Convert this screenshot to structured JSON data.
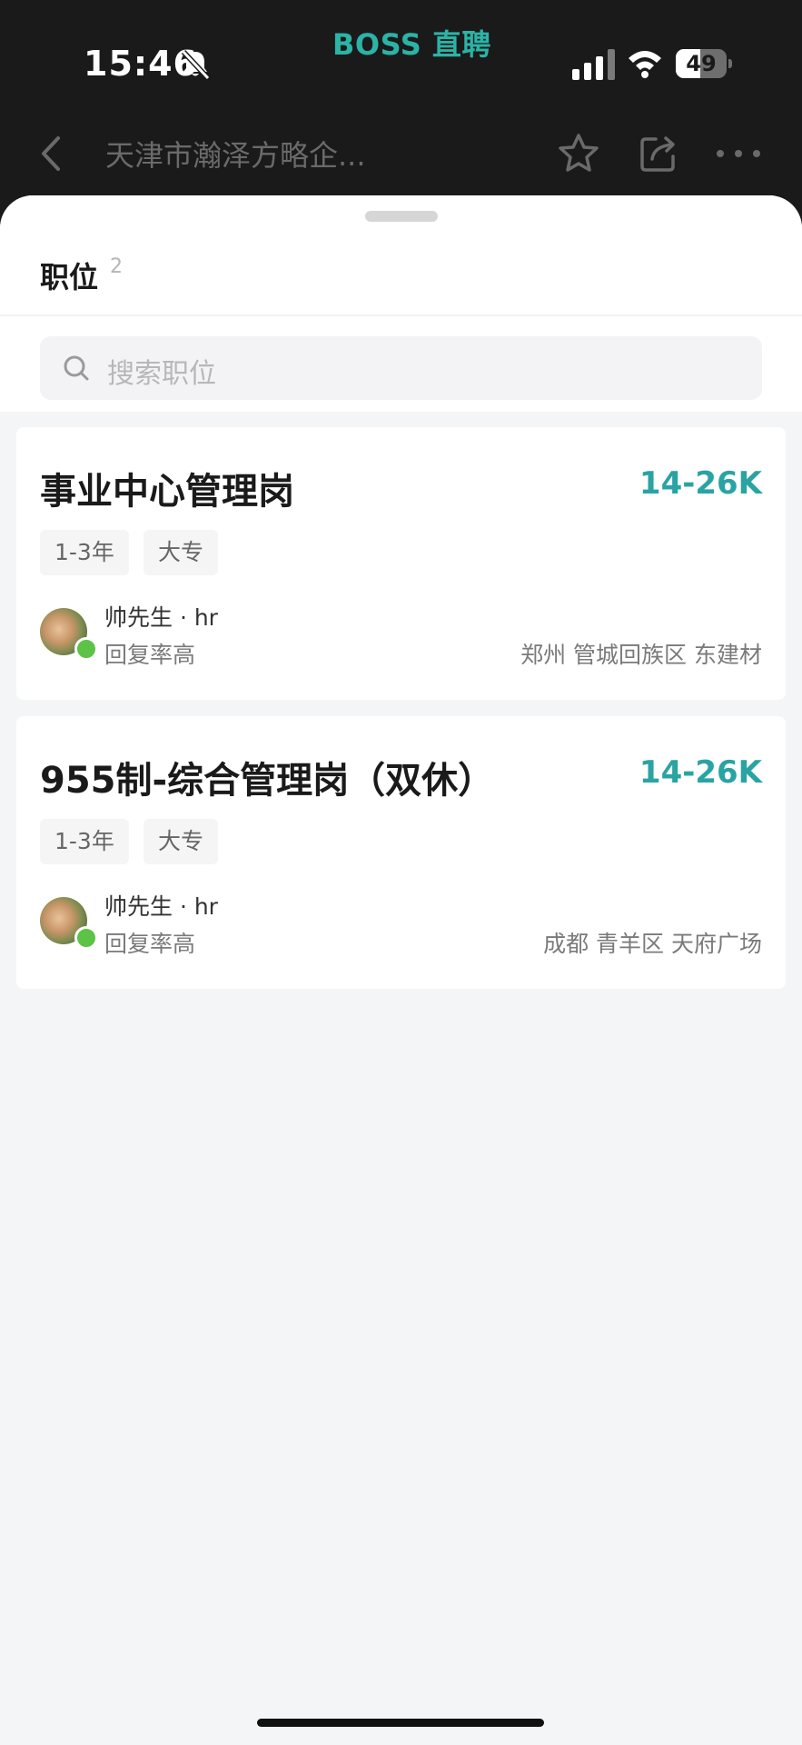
{
  "status_bar": {
    "time": "15:46",
    "app_badge": "BOSS 直聘",
    "battery": "49",
    "battery_percent": 49,
    "icons": [
      "bell-off-icon",
      "cellular-signal-icon",
      "wifi-icon",
      "battery-icon"
    ]
  },
  "header": {
    "company_title": "天津市瀚泽方略企...",
    "icons": [
      "back-icon",
      "star-icon",
      "share-icon",
      "more-icon"
    ]
  },
  "sheet": {
    "title": "职位",
    "count": "2",
    "search_placeholder": "搜索职位"
  },
  "jobs": [
    {
      "title": "事业中心管理岗",
      "salary": "14-26K",
      "tags": [
        "1-3年",
        "大专"
      ],
      "recruiter": "帅先生 · hr",
      "reply_rate": "回复率高",
      "location": "郑州 管城回族区 东建材"
    },
    {
      "title": "955制-综合管理岗（双休）",
      "salary": "14-26K",
      "tags": [
        "1-3年",
        "大专"
      ],
      "recruiter": "帅先生 · hr",
      "reply_rate": "回复率高",
      "location": "成都 青羊区 天府广场"
    }
  ],
  "colors": {
    "accent": "#2aa3a3",
    "brand": "#2bb3a6",
    "online": "#5cc346",
    "status_bar_bg": "#1a1a1a"
  }
}
